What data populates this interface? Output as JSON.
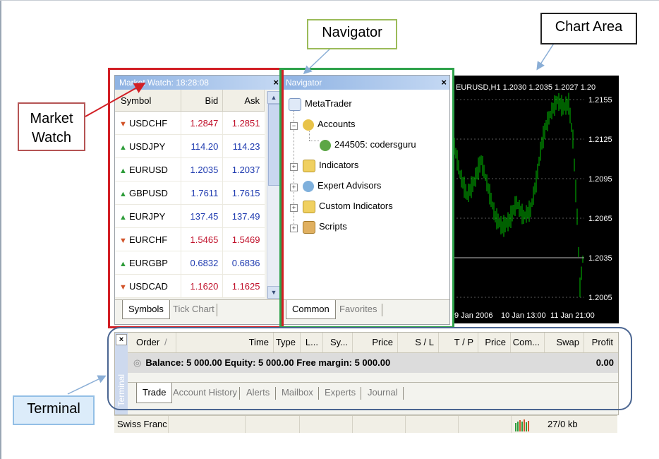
{
  "market_watch": {
    "title": "Market Watch: 18:28:08",
    "close_glyph": "×",
    "columns": [
      "Symbol",
      "Bid",
      "Ask"
    ],
    "rows": [
      {
        "symbol": "USDCHF",
        "bid": "1.2847",
        "ask": "1.2851",
        "dir": "down",
        "color": "#c0102a"
      },
      {
        "symbol": "USDJPY",
        "bid": "114.20",
        "ask": "114.23",
        "dir": "up",
        "color": "#1f3bb0"
      },
      {
        "symbol": "EURUSD",
        "bid": "1.2035",
        "ask": "1.2037",
        "dir": "up",
        "color": "#1f3bb0"
      },
      {
        "symbol": "GBPUSD",
        "bid": "1.7611",
        "ask": "1.7615",
        "dir": "up",
        "color": "#1f3bb0"
      },
      {
        "symbol": "EURJPY",
        "bid": "137.45",
        "ask": "137.49",
        "dir": "up",
        "color": "#1f3bb0"
      },
      {
        "symbol": "EURCHF",
        "bid": "1.5465",
        "ask": "1.5469",
        "dir": "down",
        "color": "#c0102a"
      },
      {
        "symbol": "EURGBP",
        "bid": "0.6832",
        "ask": "0.6836",
        "dir": "up",
        "color": "#1f3bb0"
      },
      {
        "symbol": "USDCAD",
        "bid": "1.1620",
        "ask": "1.1625",
        "dir": "down",
        "color": "#c0102a"
      }
    ],
    "tabs": [
      "Symbols",
      "Tick Chart"
    ]
  },
  "navigator": {
    "title": "Navigator",
    "close_glyph": "×",
    "tree": {
      "root": "MetaTrader",
      "accounts": "Accounts",
      "account_item": "244505: codersguru",
      "indicators": "Indicators",
      "expert_advisors": "Expert Advisors",
      "custom_indicators": "Custom Indicators",
      "scripts": "Scripts"
    },
    "tabs": [
      "Common",
      "Favorites"
    ]
  },
  "chart": {
    "header": "EURUSD,H1  1.2030 1.2035 1.2027 1.20",
    "y_ticks": [
      "1.2155",
      "1.2125",
      "1.2095",
      "1.2065",
      "1.2035",
      "1.2005"
    ],
    "x_ticks": [
      "9 Jan 2006",
      "10 Jan 13:00",
      "11 Jan 21:00"
    ],
    "colors": {
      "background": "#000000",
      "bars": "#00c000",
      "grid": "#5a5a5a",
      "text": "#ffffff"
    }
  },
  "terminal": {
    "close_glyph": "×",
    "side_label": "Terminal",
    "columns": [
      "Order",
      "/",
      "Time",
      "Type",
      "L...",
      "Sy...",
      "Price",
      "S / L",
      "T / P",
      "Price",
      "Com...",
      "Swap",
      "Profit"
    ],
    "balance_text": "Balance: 5 000.00  Equity: 5 000.00  Free margin: 5 000.00",
    "profit": "0.00",
    "tabs": [
      "Trade",
      "Account History",
      "Alerts",
      "Mailbox",
      "Experts",
      "Journal"
    ]
  },
  "status_bar": {
    "text": "Swiss Franc",
    "traffic": "27/0 kb"
  },
  "callouts": {
    "market_watch": "Market Watch",
    "navigator": "Navigator",
    "chart_area": "Chart Area",
    "terminal": "Terminal"
  }
}
